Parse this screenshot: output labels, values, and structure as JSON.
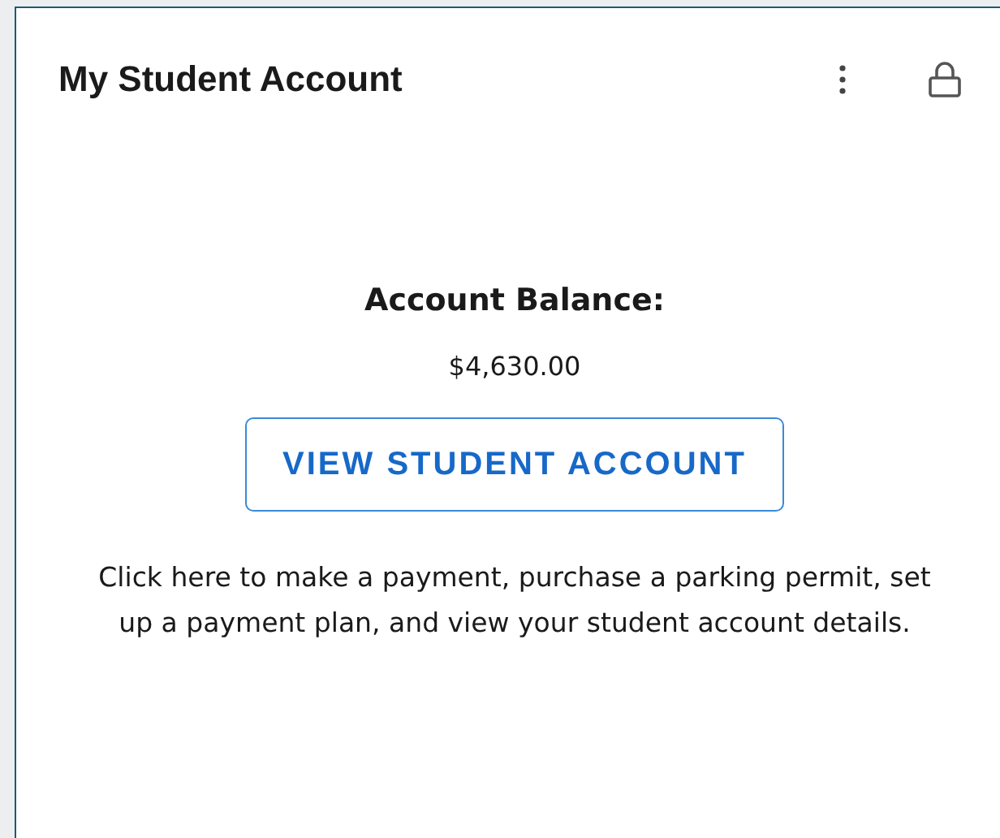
{
  "card": {
    "title": "My Student Account"
  },
  "balance": {
    "label": "Account Balance:",
    "amount": "$4,630.00"
  },
  "button": {
    "label": "VIEW STUDENT ACCOUNT"
  },
  "description": "Click here to make a payment, purchase a parking permit, set up a payment plan, and view your student account details."
}
